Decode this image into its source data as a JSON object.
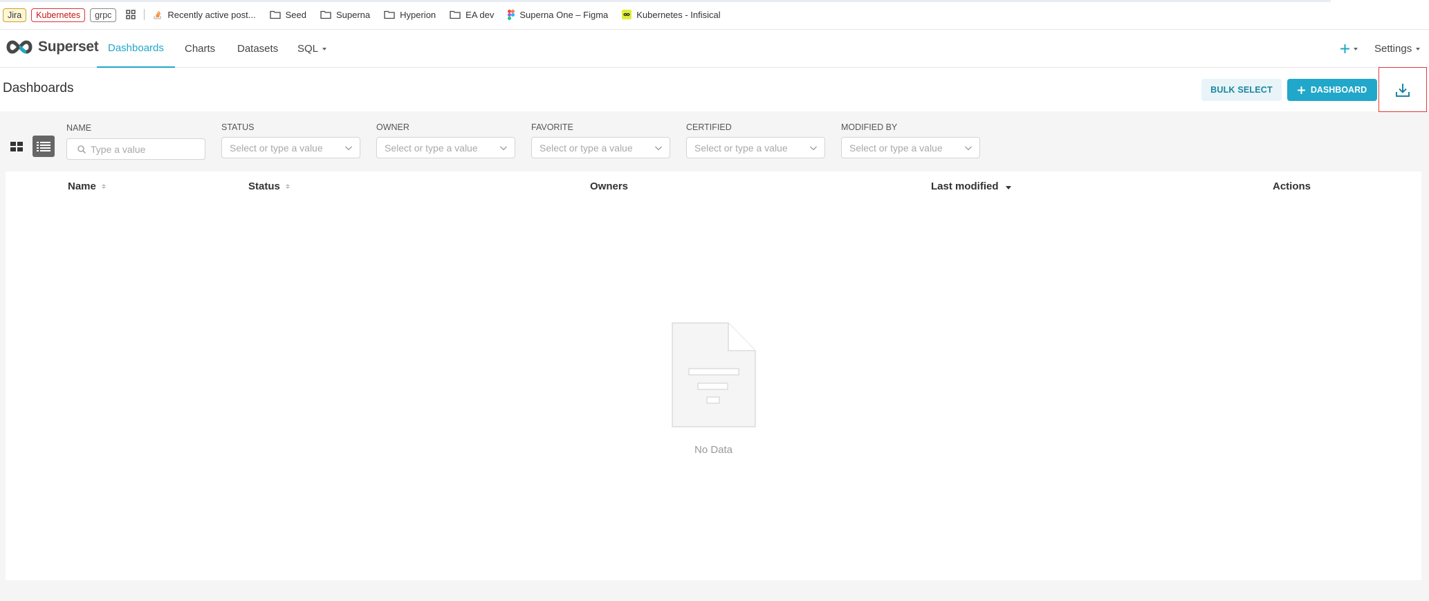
{
  "bookmarks": {
    "tags": [
      "Jira",
      "Kubernetes",
      "grpc"
    ],
    "items": [
      {
        "label": "Recently active post...",
        "icon": "stackoverflow-icon"
      },
      {
        "label": "Seed",
        "icon": "folder-icon"
      },
      {
        "label": "Superna",
        "icon": "folder-icon"
      },
      {
        "label": "Hyperion",
        "icon": "folder-icon"
      },
      {
        "label": "EA dev",
        "icon": "folder-icon"
      },
      {
        "label": "Superna One – Figma",
        "icon": "figma-icon"
      },
      {
        "label": "Kubernetes - Infisical",
        "icon": "infisical-icon"
      }
    ]
  },
  "nav": {
    "brand": "Superset",
    "items": [
      {
        "label": "Dashboards",
        "active": true
      },
      {
        "label": "Charts"
      },
      {
        "label": "Datasets"
      },
      {
        "label": "SQL",
        "dropdown": true
      }
    ],
    "settings_label": "Settings",
    "new_icon": "plus-icon"
  },
  "header": {
    "title": "Dashboards",
    "bulk_select_label": "BULK SELECT",
    "add_dashboard_label": "DASHBOARD",
    "import_icon": "download-icon"
  },
  "filters": [
    {
      "label": "NAME",
      "placeholder": "Type a value",
      "type": "search"
    },
    {
      "label": "STATUS",
      "placeholder": "Select or type a value",
      "type": "select"
    },
    {
      "label": "OWNER",
      "placeholder": "Select or type a value",
      "type": "select"
    },
    {
      "label": "FAVORITE",
      "placeholder": "Select or type a value",
      "type": "select"
    },
    {
      "label": "CERTIFIED",
      "placeholder": "Select or type a value",
      "type": "select"
    },
    {
      "label": "MODIFIED BY",
      "placeholder": "Select or type a value",
      "type": "select"
    }
  ],
  "view_mode": "list",
  "table": {
    "columns": [
      "Name",
      "Status",
      "Owners",
      "Last modified",
      "Actions"
    ],
    "sorted_by": "Last modified",
    "sort_direction": "desc",
    "rows": [],
    "empty_text": "No Data"
  },
  "colors": {
    "primary": "#20a7c9",
    "highlight_border": "#e03a3a"
  }
}
